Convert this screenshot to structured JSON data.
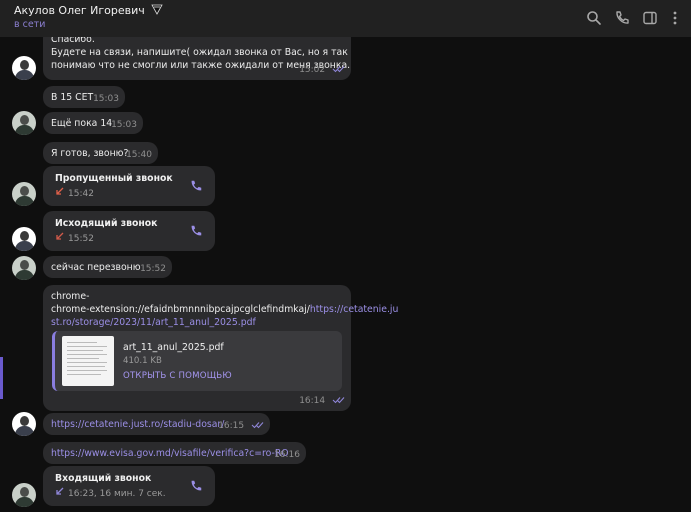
{
  "header": {
    "contact_name": "Акулов Олег Игоревич",
    "status": "в сети"
  },
  "icons": {
    "search": "search-icon",
    "call": "phone-icon",
    "sidebar": "sidebar-toggle-icon",
    "menu": "more-vertical-icon"
  },
  "colors": {
    "accent": "#8b7fd0",
    "bubble": "#2b2b2d",
    "missed": "#e0604a",
    "outgoing": "#d25a4a"
  },
  "messages": [
    {
      "id": "m1",
      "lines": [
        "Спасибо.",
        "Будете на связи, напишите( ожидал звонка от Вас, но я так",
        "понимаю что не смогли или также ожидали от меня звонка."
      ],
      "time": "15:02",
      "read": true
    },
    {
      "id": "m2",
      "text": "В 15 СЕТ",
      "time": "15:03"
    },
    {
      "id": "m3",
      "text": "Ещё пока 14",
      "time": "15:03"
    },
    {
      "id": "m4",
      "text": "Я готов, звоню?",
      "time": "15:40"
    },
    {
      "id": "m5",
      "type": "call",
      "title": "Пропущенный звонок",
      "detail": "15:42"
    },
    {
      "id": "m6",
      "type": "call",
      "title": "Исходящий звонок",
      "detail": "15:52"
    },
    {
      "id": "m7",
      "text": "сейчас перезвоню",
      "time": "15:52"
    },
    {
      "id": "m8",
      "text_plain": "chrome-extension://efaidnbmnnnibpcajpcglclefindmkaj/",
      "link_part1": "https://cetatenie.ju",
      "link_part2": "st.ro/storage/2023/11/art_11_anul_2025.pdf",
      "file_name": "art_11_anul_2025.pdf",
      "file_size": "410.1 KB",
      "file_action": "ОТКРЫТЬ С ПОМОЩЬЮ",
      "time": "16:14",
      "read": true
    },
    {
      "id": "m9",
      "link": "https://cetatenie.just.ro/stadiu-dosar/",
      "time": "16:15",
      "read": true
    },
    {
      "id": "m10",
      "link": "https://www.evisa.gov.md/visafile/verifica?c=ro-RO",
      "time": "16:16"
    },
    {
      "id": "m11",
      "type": "call",
      "title": "Входящий звонок",
      "detail": "16:23, 16 мин. 7 сек."
    }
  ]
}
